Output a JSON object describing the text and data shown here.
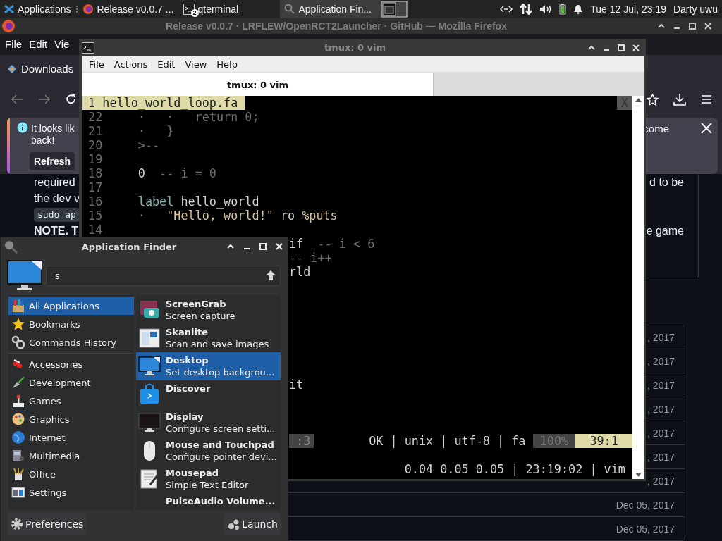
{
  "panel": {
    "menu_label": "Applications",
    "tasks": [
      {
        "label": "Release v0.0.7 ...",
        "selected": false
      },
      {
        "label": "qterminal",
        "badge": "2",
        "selected": false
      },
      {
        "label": "Application Fin...",
        "selected": true
      }
    ],
    "clock": "Tue 12 Jul, 23:19",
    "user": "Darty uwu"
  },
  "firefox": {
    "title": "Release v0.0.7 · LRFLEW/OpenRCT2Launcher · GitHub — Mozilla Firefox",
    "menu": [
      "File",
      "Edit",
      "Vie"
    ],
    "bookmark": "Downloads",
    "notification": {
      "lines": [
        "It looks lik",
        "back!"
      ],
      "button": "Refresh",
      "text_end": "come"
    },
    "article": [
      {
        "kind": "text",
        "left": "required",
        "right": "d to be"
      },
      {
        "kind": "text",
        "left": "the dev v"
      },
      {
        "kind": "code",
        "left": "sudo ap"
      },
      {
        "kind": "note",
        "left": "NOTE. T",
        "right": "e game"
      }
    ],
    "dates": [
      ", 2017",
      ", 2017",
      ", 2017",
      ", 2017",
      ", 2017",
      ", 2017",
      ", 2017",
      "Dec 05, 2017",
      "Dec 05, 2017"
    ]
  },
  "terminal": {
    "title": "tmux: 0 vim",
    "menu": [
      "File",
      "Actions",
      "Edit",
      "View",
      "Help"
    ],
    "tabs": [
      {
        "label": "tmux: 0 vim",
        "selected": true
      }
    ],
    "vim": {
      "buffer_tab": "1 hello_world_loop.fa",
      "close_label": "X",
      "rows": [
        {
          "kind": "line",
          "number": "22",
          "segments": [
            {
              "text": "·   ·   return 0;",
              "kind": "dim"
            }
          ]
        },
        {
          "kind": "line",
          "number": "21",
          "segments": [
            {
              "text": "·   }",
              "kind": "dim"
            }
          ]
        },
        {
          "kind": "line",
          "number": "20",
          "segments": [
            {
              "text": ">--",
              "kind": "dim"
            }
          ]
        },
        {
          "kind": "line",
          "number": "19"
        },
        {
          "kind": "line",
          "number": "18",
          "segments": [
            {
              "text": "0",
              "kind": "plain"
            },
            {
              "text": "  -- i = 0",
              "kind": "dim"
            }
          ]
        },
        {
          "kind": "line",
          "number": "17"
        },
        {
          "kind": "line",
          "number": "16",
          "segments": [
            {
              "text": "label",
              "kind": "keyword"
            },
            {
              "text": " hello_world",
              "kind": "plain"
            }
          ]
        },
        {
          "kind": "line",
          "number": "15",
          "segments": [
            {
              "text": "·   ",
              "kind": "dim"
            },
            {
              "text": "\"Hello, world!\"",
              "kind": "string"
            },
            {
              "text": " ro ",
              "kind": "plain"
            },
            {
              "text": "%puts",
              "kind": "string"
            }
          ]
        },
        {
          "kind": "line",
          "number": "14"
        },
        {
          "kind": "tail",
          "segments": [
            {
              "text": "if",
              "kind": "plain"
            },
            {
              "text": "  -- i < 6",
              "kind": "dim"
            }
          ]
        },
        {
          "kind": "tail",
          "segments": [
            {
              "text": "-- i++",
              "kind": "dim"
            }
          ]
        },
        {
          "kind": "tail",
          "segments": [
            {
              "text": "rld",
              "kind": "plain"
            }
          ]
        },
        {
          "kind": "blank"
        },
        {
          "kind": "blank"
        },
        {
          "kind": "blank"
        },
        {
          "kind": "blank"
        },
        {
          "kind": "blank"
        },
        {
          "kind": "blank"
        },
        {
          "kind": "blank"
        },
        {
          "kind": "tail",
          "segments": [
            {
              "text": "it",
              "kind": "plain"
            }
          ]
        },
        {
          "kind": "blank"
        },
        {
          "kind": "blank"
        },
        {
          "kind": "blank"
        }
      ],
      "status": {
        "mode": ":3",
        "info": "OK | unix | utf-8 | fa",
        "percent": "100%",
        "position": "39:1"
      }
    },
    "tmux_status": "0.04 0.05 0.05 | 23:19:02 | vim"
  },
  "finder": {
    "title": "Application Finder",
    "query": "s",
    "places": [
      {
        "label": "All Applications",
        "selected": true
      },
      {
        "label": "Bookmarks",
        "selected": false
      },
      {
        "label": "Commands History",
        "selected": false
      }
    ],
    "categories": [
      {
        "label": "Accessories",
        "selected": false
      },
      {
        "label": "Development",
        "selected": false
      },
      {
        "label": "Games",
        "selected": false
      },
      {
        "label": "Graphics",
        "selected": false
      },
      {
        "label": "Internet",
        "selected": false
      },
      {
        "label": "Multimedia",
        "selected": false
      },
      {
        "label": "Office",
        "selected": false
      },
      {
        "label": "Settings",
        "selected": false
      }
    ],
    "apps": [
      {
        "name": "ScreenGrab",
        "description": "Screen capture",
        "selected": false
      },
      {
        "name": "Skanlite",
        "description": "Scan and save images",
        "selected": false
      },
      {
        "name": "Desktop",
        "description": "Set desktop backgrou...",
        "selected": true
      },
      {
        "name": "Discover",
        "selected": false
      },
      {
        "name": "Display",
        "description": "Configure screen setti...",
        "selected": false
      },
      {
        "name": "Mouse and Touchpad",
        "description": "Configure pointer devi...",
        "selected": false
      },
      {
        "name": "Mousepad",
        "description": "Simple Text Editor",
        "selected": false
      },
      {
        "name": "PulseAudio Volume...",
        "selected": false
      }
    ],
    "preferences": "Preferences",
    "launch": "Launch"
  }
}
